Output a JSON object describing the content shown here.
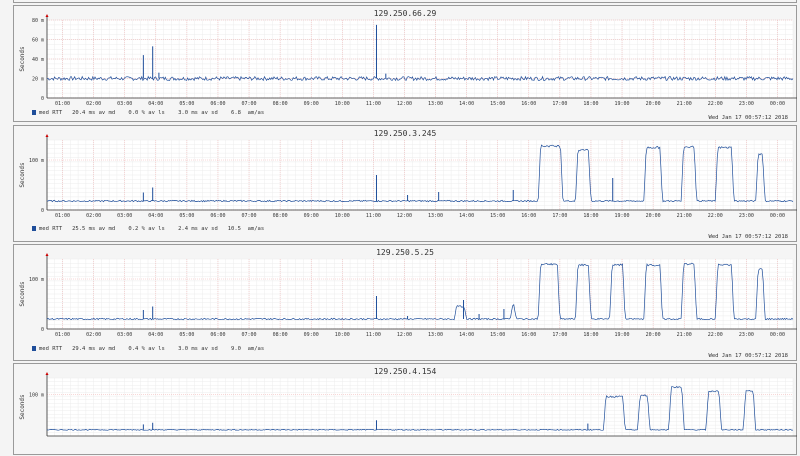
{
  "chart_data": [
    {
      "type": "line",
      "title": "129.250.66.29",
      "ylabel": "Seconds",
      "yticks": [
        "0",
        "20 m",
        "40 m",
        "60 m",
        "80 m"
      ],
      "ytick_values": [
        0,
        20,
        40,
        60,
        80
      ],
      "ylim": [
        0,
        80
      ],
      "xticks": [
        "01:00",
        "02:00",
        "03:00",
        "04:00",
        "05:00",
        "06:00",
        "07:00",
        "08:00",
        "09:00",
        "10:00",
        "11:00",
        "12:00",
        "13:00",
        "14:00",
        "15:00",
        "16:00",
        "17:00",
        "18:00",
        "19:00",
        "20:00",
        "21:00",
        "22:00",
        "23:00",
        "00:00"
      ],
      "legend": "med RTT   20.4 ms av md    0.0 % av ls    3.0 ms av sd    6.8  am/as",
      "timestamp": "Wed Jan 17 00:57:12 2018",
      "grid": true,
      "series": [
        {
          "name": "med RTT",
          "color": "#1f4e9a",
          "baseline": 20,
          "noise": 2,
          "spikes": [
            [
              3.6,
              44
            ],
            [
              3.9,
              53
            ],
            [
              4.1,
              26
            ],
            [
              11.1,
              75
            ],
            [
              11.4,
              25
            ]
          ],
          "plateaus": []
        }
      ]
    },
    {
      "type": "line",
      "title": "129.250.3.245",
      "ylabel": "Seconds",
      "yticks": [
        "0",
        "100 m"
      ],
      "ytick_values": [
        0,
        100
      ],
      "ylim": [
        0,
        140
      ],
      "xticks": [
        "01:00",
        "02:00",
        "03:00",
        "04:00",
        "05:00",
        "06:00",
        "07:00",
        "08:00",
        "09:00",
        "10:00",
        "11:00",
        "12:00",
        "13:00",
        "14:00",
        "15:00",
        "16:00",
        "17:00",
        "18:00",
        "19:00",
        "20:00",
        "21:00",
        "22:00",
        "23:00",
        "00:00"
      ],
      "legend": "med RTT   25.5 ms av md    0.2 % av ls    2.4 ms av sd   10.5  am/as",
      "timestamp": "Wed Jan 17 00:57:12 2018",
      "grid": true,
      "series": [
        {
          "name": "med RTT",
          "color": "#1f4e9a",
          "baseline": 18,
          "noise": 1.5,
          "spikes": [
            [
              3.6,
              35
            ],
            [
              3.9,
              45
            ],
            [
              11.1,
              70
            ],
            [
              12.1,
              30
            ],
            [
              13.1,
              36
            ],
            [
              15.5,
              40
            ],
            [
              18.7,
              64
            ]
          ],
          "plateaus": [
            [
              16.3,
              17.1,
              128
            ],
            [
              17.5,
              18.0,
              120
            ],
            [
              19.7,
              20.3,
              125
            ],
            [
              20.9,
              21.4,
              126
            ],
            [
              22.0,
              22.6,
              125
            ],
            [
              23.3,
              23.6,
              112
            ]
          ]
        }
      ]
    },
    {
      "type": "line",
      "title": "129.250.5.25",
      "ylabel": "Seconds",
      "yticks": [
        "0",
        "100 m"
      ],
      "ytick_values": [
        0,
        100
      ],
      "ylim": [
        0,
        140
      ],
      "xticks": [
        "01:00",
        "02:00",
        "03:00",
        "04:00",
        "05:00",
        "06:00",
        "07:00",
        "08:00",
        "09:00",
        "10:00",
        "11:00",
        "12:00",
        "13:00",
        "14:00",
        "15:00",
        "16:00",
        "17:00",
        "18:00",
        "19:00",
        "20:00",
        "21:00",
        "22:00",
        "23:00",
        "00:00"
      ],
      "legend": "med RTT   29.4 ms av md    0.4 % av ls    3.0 ms av sd    9.0  am/as",
      "timestamp": "Wed Jan 17 00:57:12 2018",
      "grid": true,
      "series": [
        {
          "name": "med RTT",
          "color": "#1f4e9a",
          "baseline": 20,
          "noise": 1.5,
          "spikes": [
            [
              3.6,
              38
            ],
            [
              3.9,
              45
            ],
            [
              11.1,
              66
            ],
            [
              12.1,
              26
            ],
            [
              13.9,
              58
            ],
            [
              14.4,
              30
            ],
            [
              15.2,
              40
            ]
          ],
          "plateaus": [
            [
              13.6,
              14.0,
              45
            ],
            [
              15.4,
              15.6,
              48
            ],
            [
              16.3,
              17.0,
              130
            ],
            [
              17.5,
              18.0,
              128
            ],
            [
              18.6,
              19.1,
              128
            ],
            [
              19.7,
              20.3,
              128
            ],
            [
              20.9,
              21.4,
              130
            ],
            [
              22.0,
              22.6,
              128
            ],
            [
              23.3,
              23.6,
              120
            ]
          ]
        }
      ]
    },
    {
      "type": "line",
      "title": "129.250.4.154",
      "ylabel": "Seconds",
      "yticks": [
        "100 m"
      ],
      "ytick_values": [
        100
      ],
      "ylim": [
        0,
        140
      ],
      "xticks": [],
      "legend": "",
      "timestamp": "",
      "grid": true,
      "series": [
        {
          "name": "med RTT",
          "color": "#1f4e9a",
          "baseline": 15,
          "noise": 1.2,
          "spikes": [
            [
              3.6,
              28
            ],
            [
              3.9,
              32
            ],
            [
              11.1,
              38
            ],
            [
              17.9,
              30
            ]
          ],
          "plateaus": [
            [
              18.4,
              19.1,
              95
            ],
            [
              19.5,
              19.9,
              98
            ],
            [
              20.5,
              21.0,
              118
            ],
            [
              21.7,
              22.2,
              108
            ],
            [
              22.9,
              23.3,
              110
            ]
          ]
        }
      ]
    }
  ]
}
